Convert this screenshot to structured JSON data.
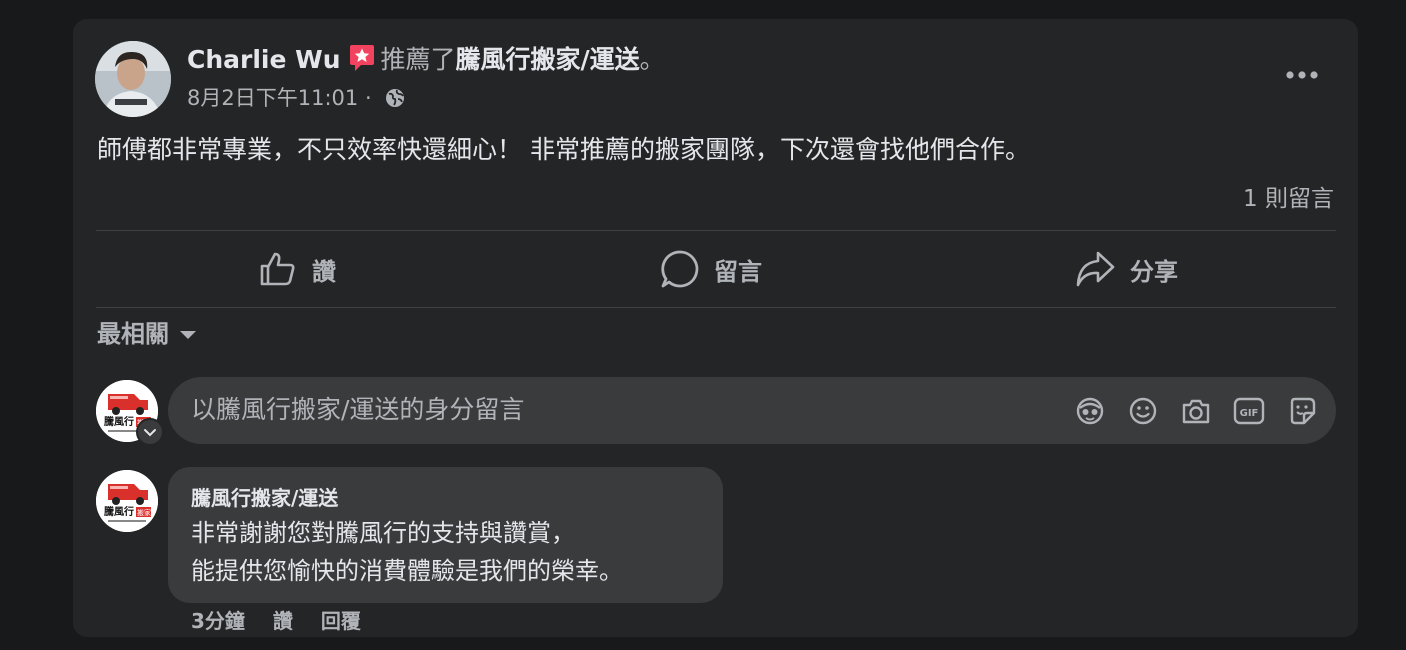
{
  "post": {
    "author": "Charlie Wu",
    "verb": "推薦了",
    "page_name": "騰風行搬家/運送",
    "period": "。",
    "timestamp": "8月2日下午11:01",
    "separator": "·",
    "body": "師傅都非常專業，不只效率快還細心！ 非常推薦的搬家團隊，下次還會找他們合作。",
    "comment_count": "1 則留言"
  },
  "actions": {
    "like": "讚",
    "comment": "留言",
    "share": "分享"
  },
  "sort": {
    "label": "最相關"
  },
  "composer": {
    "placeholder": "以騰風行搬家/運送的身分留言"
  },
  "reply": {
    "author": "騰風行搬家/運送",
    "line1": "非常謝謝您對騰風行的支持與讚賞，",
    "line2": "能提供您愉快的消費體驗是我們的榮幸。",
    "time": "3分鐘",
    "like": "讚",
    "reply_label": "回覆"
  },
  "page_logo": {
    "text": "騰風行",
    "tag": "搬家"
  },
  "colors": {
    "background": "#18191a",
    "card": "#242526",
    "input": "#3a3b3c",
    "primary_text": "#e4e6eb",
    "secondary_text": "#b0b3b8",
    "recommend_badge": "#f3425f",
    "brand_red": "#d9302c"
  },
  "icons": {
    "recommend": "recommend-star-icon",
    "privacy": "globe-icon",
    "more": "more-horizontal-icon",
    "like": "thumbs-up-icon",
    "comment": "comment-bubble-icon",
    "share": "share-arrow-icon",
    "avatar_stickers": "avatar-sticker-icon",
    "emoji": "emoji-icon",
    "camera": "camera-icon",
    "gif": "gif-icon",
    "sticker": "sticker-icon"
  }
}
